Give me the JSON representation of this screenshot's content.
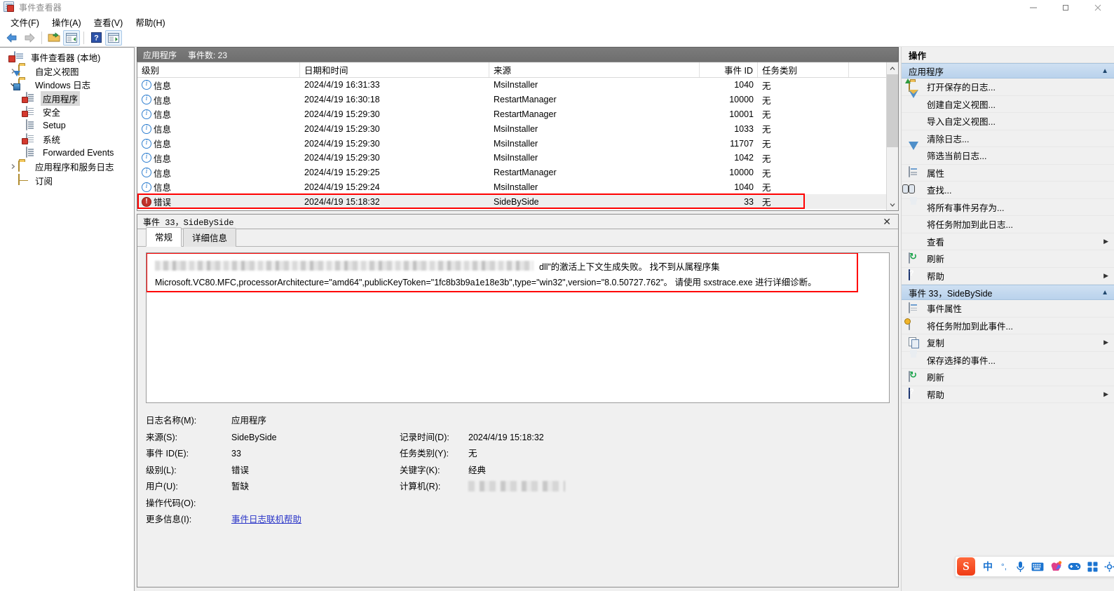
{
  "window": {
    "title": "事件查看器",
    "icon": "event-viewer-icon",
    "controls": {
      "minimize": "minimize-icon",
      "maximize": "maximize-icon",
      "close": "close-icon"
    }
  },
  "menu": {
    "items": [
      {
        "label": "文件(F)",
        "name": "menu-file"
      },
      {
        "label": "操作(A)",
        "name": "menu-action"
      },
      {
        "label": "查看(V)",
        "name": "menu-view"
      },
      {
        "label": "帮助(H)",
        "name": "menu-help"
      }
    ]
  },
  "toolbar": {
    "buttons": [
      {
        "name": "back-button",
        "icon": "back-arrow-icon",
        "framed": false
      },
      {
        "name": "forward-button",
        "icon": "forward-arrow-icon",
        "framed": false
      },
      {
        "name": "open-folder-button",
        "icon": "open-folder-icon",
        "framed": false
      },
      {
        "name": "show-hide-tree-button",
        "icon": "console-tree-icon",
        "framed": true
      },
      {
        "name": "help-button",
        "icon": "help-question-icon",
        "framed": false
      },
      {
        "name": "show-hide-action-pane-button",
        "icon": "action-pane-icon",
        "framed": true
      }
    ]
  },
  "tree": {
    "nodes": [
      {
        "label": "事件查看器 (本地)",
        "icon": "event-viewer-root-icon",
        "indent": 0,
        "twist": "none",
        "selected": false,
        "name": "tree-node-event-viewer-root"
      },
      {
        "label": "自定义视图",
        "icon": "custom-views-folder-icon",
        "indent": 1,
        "twist": "collapsed",
        "selected": false,
        "name": "tree-node-custom-views"
      },
      {
        "label": "Windows 日志",
        "icon": "windows-logs-folder-icon",
        "indent": 1,
        "twist": "expanded",
        "selected": false,
        "name": "tree-node-windows-logs"
      },
      {
        "label": "应用程序",
        "icon": "application-log-icon",
        "indent": 2,
        "twist": "none",
        "selected": true,
        "name": "tree-node-application"
      },
      {
        "label": "安全",
        "icon": "security-log-icon",
        "indent": 2,
        "twist": "none",
        "selected": false,
        "name": "tree-node-security"
      },
      {
        "label": "Setup",
        "icon": "setup-log-icon",
        "indent": 2,
        "twist": "none",
        "selected": false,
        "name": "tree-node-setup"
      },
      {
        "label": "系统",
        "icon": "system-log-icon",
        "indent": 2,
        "twist": "none",
        "selected": false,
        "name": "tree-node-system"
      },
      {
        "label": "Forwarded Events",
        "icon": "forwarded-events-log-icon",
        "indent": 2,
        "twist": "none",
        "selected": false,
        "name": "tree-node-forwarded-events"
      },
      {
        "label": "应用程序和服务日志",
        "icon": "apps-services-logs-folder-icon",
        "indent": 1,
        "twist": "collapsed",
        "selected": false,
        "name": "tree-node-apps-and-services-logs"
      },
      {
        "label": "订阅",
        "icon": "subscriptions-icon",
        "indent": 1,
        "twist": "none",
        "selected": false,
        "name": "tree-node-subscriptions"
      }
    ]
  },
  "list": {
    "header_title": "应用程序",
    "header_count": "事件数: 23",
    "columns": [
      {
        "label": "级别",
        "name": "column-level"
      },
      {
        "label": "日期和时间",
        "name": "column-datetime"
      },
      {
        "label": "来源",
        "name": "column-source"
      },
      {
        "label": "事件 ID",
        "name": "column-event-id"
      },
      {
        "label": "任务类别",
        "name": "column-task-category"
      }
    ],
    "rows": [
      {
        "level": "信息",
        "level_type": "info",
        "datetime": "2024/4/19 16:31:33",
        "source": "MsiInstaller",
        "event_id": "1040",
        "task": "无",
        "selected": false
      },
      {
        "level": "信息",
        "level_type": "info",
        "datetime": "2024/4/19 16:30:18",
        "source": "RestartManager",
        "event_id": "10000",
        "task": "无",
        "selected": false
      },
      {
        "level": "信息",
        "level_type": "info",
        "datetime": "2024/4/19 15:29:30",
        "source": "RestartManager",
        "event_id": "10001",
        "task": "无",
        "selected": false
      },
      {
        "level": "信息",
        "level_type": "info",
        "datetime": "2024/4/19 15:29:30",
        "source": "MsiInstaller",
        "event_id": "1033",
        "task": "无",
        "selected": false
      },
      {
        "level": "信息",
        "level_type": "info",
        "datetime": "2024/4/19 15:29:30",
        "source": "MsiInstaller",
        "event_id": "11707",
        "task": "无",
        "selected": false
      },
      {
        "level": "信息",
        "level_type": "info",
        "datetime": "2024/4/19 15:29:30",
        "source": "MsiInstaller",
        "event_id": "1042",
        "task": "无",
        "selected": false
      },
      {
        "level": "信息",
        "level_type": "info",
        "datetime": "2024/4/19 15:29:25",
        "source": "RestartManager",
        "event_id": "10000",
        "task": "无",
        "selected": false
      },
      {
        "level": "信息",
        "level_type": "info",
        "datetime": "2024/4/19 15:29:24",
        "source": "MsiInstaller",
        "event_id": "1040",
        "task": "无",
        "selected": false
      },
      {
        "level": "错误",
        "level_type": "error",
        "datetime": "2024/4/19 15:18:32",
        "source": "SideBySide",
        "event_id": "33",
        "task": "无",
        "selected": true
      }
    ],
    "highlight_color": "#ff0000"
  },
  "detail": {
    "title": "事件 33，SideBySide",
    "close_icon": "close-icon",
    "tabs": [
      {
        "label": "常规",
        "name": "tab-general",
        "active": true
      },
      {
        "label": "详细信息",
        "name": "tab-details",
        "active": false
      }
    ],
    "message_line1_redacted": true,
    "message_line1_tail": "dll”的激活上下文生成失败。 找不到从属程序集",
    "message_line2": "Microsoft.VC80.MFC,processorArchitecture=\"amd64\",publicKeyToken=\"1fc8b3b9a1e18e3b\",type=\"win32\",version=\"8.0.50727.762\"。 请使用 sxstrace.exe 进行详细诊断。",
    "highlight_color": "#ff0000",
    "fields": {
      "log_name_label": "日志名称(M):",
      "log_name_value": "应用程序",
      "source_label": "来源(S):",
      "source_value": "SideBySide",
      "logged_label": "记录时间(D):",
      "logged_value": "2024/4/19 15:18:32",
      "event_id_label": "事件 ID(E):",
      "event_id_value": "33",
      "task_category_label": "任务类别(Y):",
      "task_category_value": "无",
      "level_label": "级别(L):",
      "level_value": "错误",
      "keywords_label": "关键字(K):",
      "keywords_value": "经典",
      "user_label": "用户(U):",
      "user_value": "暂缺",
      "computer_label": "计算机(R):",
      "computer_value": "",
      "opcode_label": "操作代码(O):",
      "opcode_value": "",
      "more_info_label": "更多信息(I):",
      "more_info_link": "事件日志联机帮助"
    }
  },
  "actions": {
    "title": "操作",
    "groups": [
      {
        "name": "action-group-application",
        "header": "应用程序",
        "collapse_icon": "chevron-up-icon",
        "items": [
          {
            "label": "打开保存的日志...",
            "icon": "open-saved-log-icon",
            "name": "action-open-saved-log",
            "submenu": false
          },
          {
            "label": "创建自定义视图...",
            "icon": "create-custom-view-icon",
            "name": "action-create-custom-view",
            "submenu": false
          },
          {
            "label": "导入自定义视图...",
            "icon": "none",
            "name": "action-import-custom-view",
            "submenu": false
          },
          {
            "label": "清除日志...",
            "icon": "none",
            "name": "action-clear-log",
            "submenu": false
          },
          {
            "label": "筛选当前日志...",
            "icon": "filter-icon",
            "name": "action-filter-current-log",
            "submenu": false
          },
          {
            "label": "属性",
            "icon": "properties-icon",
            "name": "action-properties",
            "submenu": false
          },
          {
            "label": "查找...",
            "icon": "find-binoculars-icon",
            "name": "action-find",
            "submenu": false
          },
          {
            "label": "将所有事件另存为...",
            "icon": "save-icon",
            "name": "action-save-all-events-as",
            "submenu": false
          },
          {
            "label": "将任务附加到此日志...",
            "icon": "none",
            "name": "action-attach-task-to-log",
            "submenu": false
          },
          {
            "label": "查看",
            "icon": "none",
            "name": "action-view",
            "submenu": true
          },
          {
            "label": "刷新",
            "icon": "refresh-icon",
            "name": "action-refresh",
            "submenu": false
          },
          {
            "label": "帮助",
            "icon": "help-icon",
            "name": "action-help",
            "submenu": true
          }
        ]
      },
      {
        "name": "action-group-event",
        "header": "事件 33，SideBySide",
        "collapse_icon": "chevron-up-icon",
        "items": [
          {
            "label": "事件属性",
            "icon": "event-properties-icon",
            "name": "action-event-properties",
            "submenu": false
          },
          {
            "label": "将任务附加到此事件...",
            "icon": "attach-task-icon",
            "name": "action-attach-task-to-event",
            "submenu": false
          },
          {
            "label": "复制",
            "icon": "copy-icon",
            "name": "action-copy",
            "submenu": true
          },
          {
            "label": "保存选择的事件...",
            "icon": "save-icon",
            "name": "action-save-selected-events",
            "submenu": false
          },
          {
            "label": "刷新",
            "icon": "refresh-icon",
            "name": "action-refresh-event",
            "submenu": false
          },
          {
            "label": "帮助",
            "icon": "help-icon",
            "name": "action-help-event",
            "submenu": true
          }
        ]
      }
    ]
  },
  "ime": {
    "logo": "S",
    "logo_color": "#f24e1e",
    "items": [
      {
        "label": "中",
        "name": "ime-chinese-mode-button",
        "icon": "chinese-mode-icon"
      },
      {
        "label": "°,",
        "name": "ime-punctuation-button",
        "icon": "punctuation-icon"
      },
      {
        "label": "",
        "name": "ime-voice-input-button",
        "icon": "microphone-icon"
      },
      {
        "label": "",
        "name": "ime-soft-keyboard-button",
        "icon": "keyboard-icon"
      },
      {
        "label": "",
        "name": "ime-emoji-button",
        "icon": "emoji-icon"
      },
      {
        "label": "",
        "name": "ime-game-button",
        "icon": "gamepad-icon"
      },
      {
        "label": "",
        "name": "ime-toolbox-button",
        "icon": "grid-apps-icon"
      },
      {
        "label": "",
        "name": "ime-settings-button",
        "icon": "settings-icon"
      }
    ]
  }
}
